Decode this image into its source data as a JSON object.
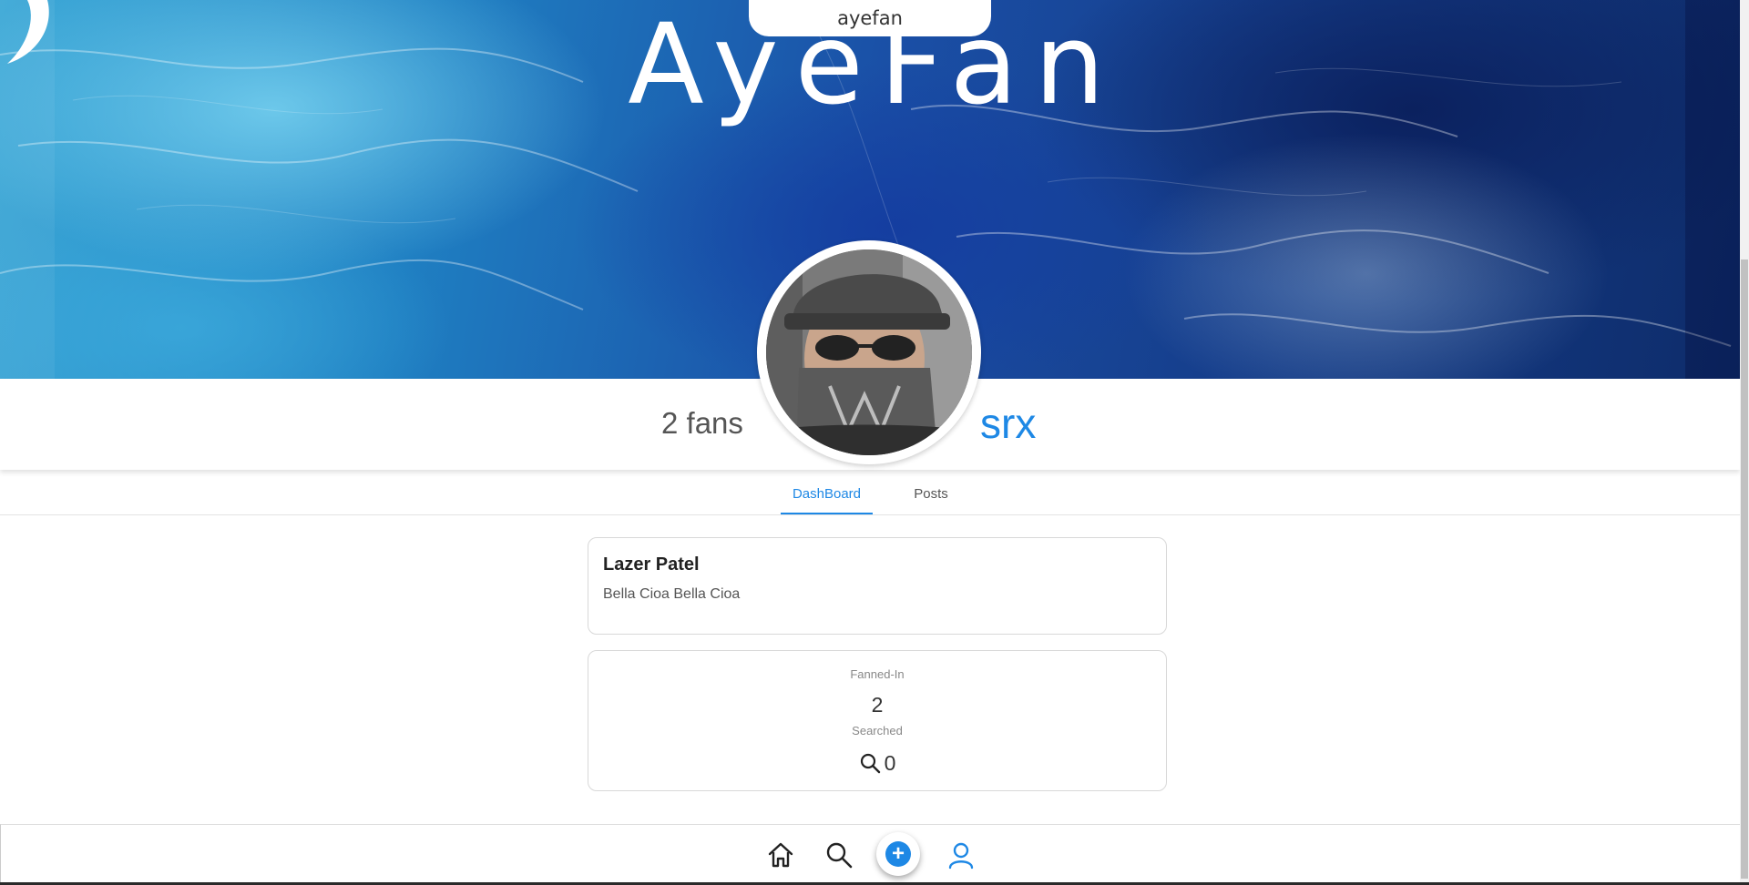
{
  "banner": {
    "logo_text": "AyeFan",
    "brand_pill": "ayefan"
  },
  "profile": {
    "fans_count": "2 fans",
    "username": "srx"
  },
  "tabs": [
    {
      "label": "DashBoard",
      "active": true
    },
    {
      "label": "Posts",
      "active": false
    }
  ],
  "bio": {
    "name": "Lazer Patel",
    "text": "Bella Cioa Bella Cioa"
  },
  "stats": {
    "fanned_in_label": "Fanned-In",
    "fanned_in_value": "2",
    "searched_label": "Searched",
    "searched_value": "0"
  },
  "nav": {
    "items": [
      "home-icon",
      "search-icon",
      "plus-icon",
      "user-icon"
    ],
    "add_symbol": "+"
  },
  "colors": {
    "accent": "#1e88e5",
    "text_muted": "#555555"
  }
}
